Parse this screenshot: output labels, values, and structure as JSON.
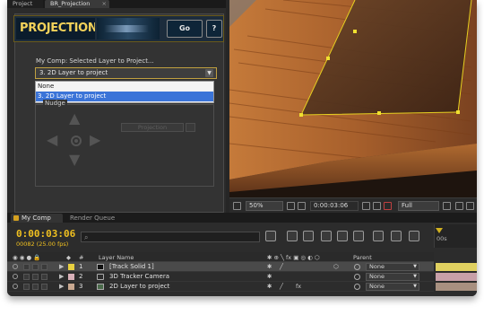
{
  "panel_tabs": {
    "project": "Project",
    "br_projection": "BR_Projection"
  },
  "header": {
    "logo": "PROJECTION",
    "go": "Go",
    "help": "?"
  },
  "form": {
    "comp_label": "My Comp: Selected Layer to Project...",
    "selected_value": "3. 2D Layer to project",
    "options": [
      "None",
      "3. 2D Layer to project"
    ],
    "nudge_label": "Nudge",
    "projection_button": "Projection"
  },
  "viewer_bar": {
    "zoom": "50%",
    "timecode": "0:00:03:06",
    "quality": "Full"
  },
  "timeline": {
    "tab_comp": "My Comp",
    "tab_render": "Render Queue",
    "timecode": "0:00:03:06",
    "frames": "00082 (25.00 fps)",
    "ruler": "00s",
    "col_num": "#",
    "col_layer_name": "Layer Name",
    "col_parent": "Parent"
  },
  "layers": [
    {
      "num": "1",
      "name": "[Track Solid 1]",
      "parent": "None",
      "swatch": "#e8d040",
      "track": "#e0d060"
    },
    {
      "num": "2",
      "name": "3D Tracker Camera",
      "parent": "None",
      "swatch": "#d8b0b8",
      "track": "#c8a0a8"
    },
    {
      "num": "3",
      "name": "2D Layer to project",
      "parent": "None",
      "swatch": "#c8a890",
      "track": "#a89080"
    }
  ],
  "colors": {
    "accent": "#f0c020",
    "selection": "#3b74d8"
  }
}
